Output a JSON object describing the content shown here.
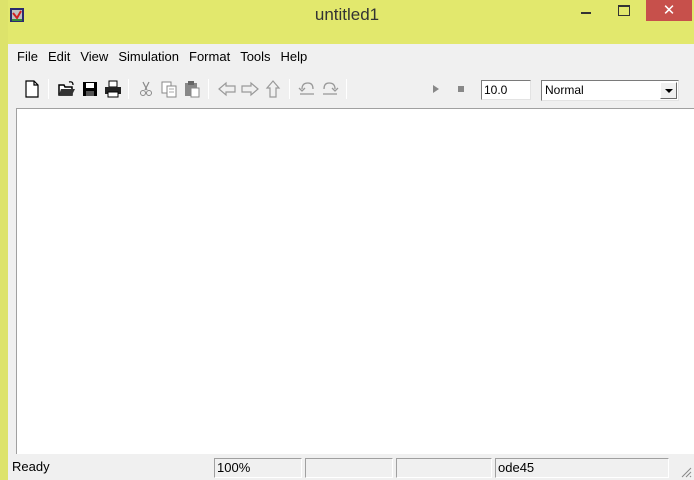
{
  "window": {
    "title": "untitled1",
    "close_glyph": "✕",
    "frame_color": "#e2e86d",
    "close_color": "#c7504b"
  },
  "menu": [
    "File",
    "Edit",
    "View",
    "Simulation",
    "Format",
    "Tools",
    "Help"
  ],
  "toolbar": {
    "icons": [
      "new-icon",
      "open-icon",
      "save-icon",
      "print-icon",
      "cut-icon",
      "copy-icon",
      "paste-icon",
      "back-icon",
      "forward-icon",
      "up-icon",
      "undo-icon",
      "redo-icon",
      "play-icon",
      "stop-icon"
    ],
    "stop_time": "10.0",
    "sim_mode": "Normal"
  },
  "status": {
    "state": "Ready",
    "zoom": "100%",
    "field3": "",
    "field4": "",
    "solver": "ode45"
  }
}
